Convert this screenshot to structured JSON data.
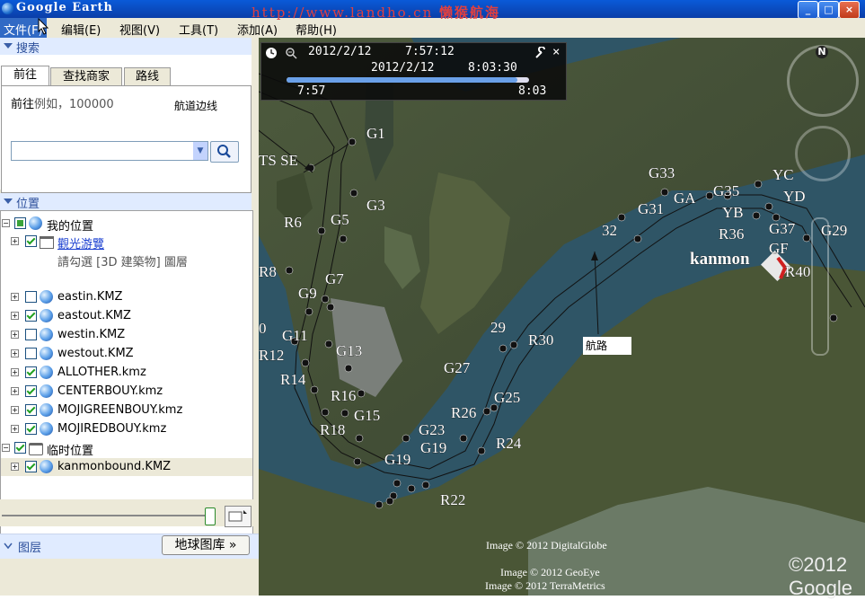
{
  "window": {
    "title": "Google Earth",
    "watermark_url": "http://www.landho.cn",
    "watermark_cn": "懒猴航海",
    "min": "_",
    "max": "□",
    "close": "×"
  },
  "menu": [
    "文件(F)",
    "编辑(E)",
    "视图(V)",
    "工具(T)",
    "添加(A)",
    "帮助(H)"
  ],
  "search": {
    "header": "搜索",
    "tabs": [
      "前往",
      "查找商家",
      "路线"
    ],
    "goto_label": "前往",
    "goto_hint": "例如，100000",
    "input_value": ""
  },
  "places": {
    "header": "位置",
    "my_places": "我的位置",
    "sightseeing": "觀光游覽",
    "sightseeing_note": "請勾選 [3D 建築物] 圖層",
    "items": [
      {
        "label": "eastin.KMZ",
        "checked": false
      },
      {
        "label": "eastout.KMZ",
        "checked": true
      },
      {
        "label": "westin.KMZ",
        "checked": false
      },
      {
        "label": "westout.KMZ",
        "checked": false
      },
      {
        "label": "ALLOTHER.kmz",
        "checked": true
      },
      {
        "label": "CENTERBOUY.kmz",
        "checked": true
      },
      {
        "label": "MOJIGREENBOUY.kmz",
        "checked": true
      },
      {
        "label": "MOJIREDBOUY.kmz",
        "checked": true
      }
    ],
    "temp_places": "临时位置",
    "temp_item": "kanmonbound.KMZ"
  },
  "layers": {
    "header": "图层",
    "gallery_button": "地球图库 »"
  },
  "timebar": {
    "date1": "2012/2/12",
    "time1": "7:57:12",
    "date2": "2012/2/12",
    "time2": "8:03:30",
    "start": "7:57",
    "end": "8:03",
    "progress": 0.95
  },
  "map": {
    "compass_n": "N",
    "annotation_channel_edge": "航道边线",
    "annotation_route": "航路",
    "place_label": "kanmon",
    "buoys": [
      "G1",
      "G3",
      "G5",
      "G7",
      "G9",
      "G11",
      "G13",
      "G15",
      "G19",
      "G19",
      "G23",
      "G25",
      "G27",
      "29",
      "G31",
      "32",
      "G33",
      "GA",
      "G35",
      "YB",
      "YC",
      "YD",
      "G37",
      "GF",
      "G29",
      "R6",
      "R8",
      "R12",
      "R14",
      "R16",
      "R18",
      "R22",
      "R24",
      "R26",
      "R30",
      "R36",
      "R40",
      "TS SE",
      "0"
    ],
    "credits": [
      "Image © 2012 DigitalGlobe",
      "Image © 2012 GeoEye",
      "Image © 2012 TerraMetrics"
    ],
    "logo": "©2012 Google"
  }
}
